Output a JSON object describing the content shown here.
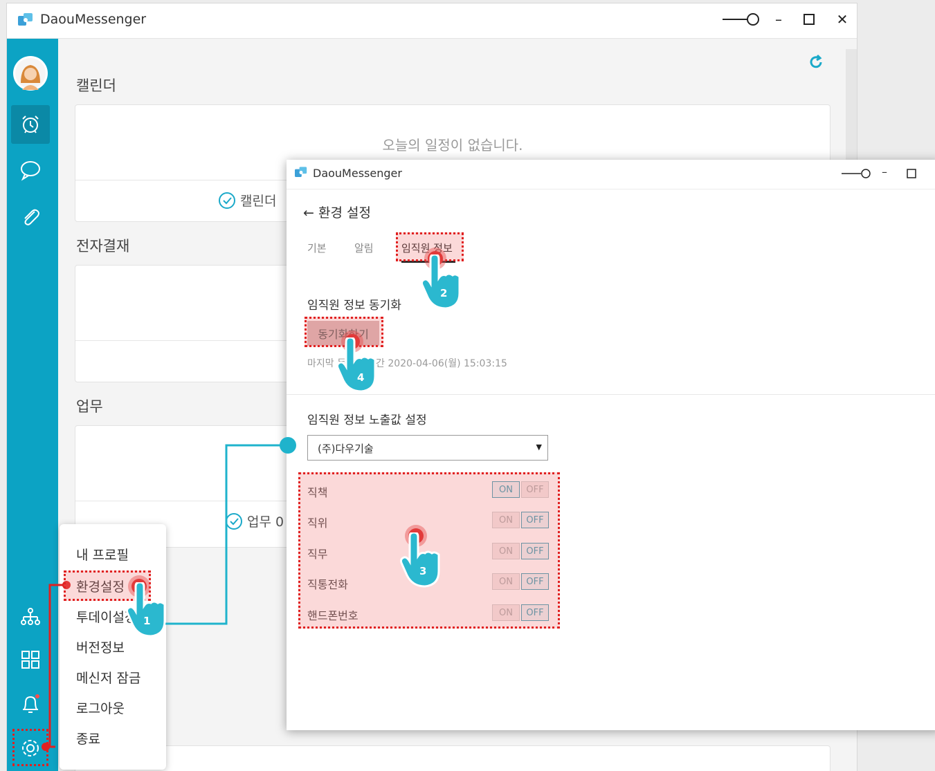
{
  "main_window": {
    "title": "DaouMessenger",
    "sections": {
      "calendar": {
        "title": "캘린더",
        "empty": "오늘의 일정이 없습니다.",
        "link": "캘린더"
      },
      "approval": {
        "title": "전자결재"
      },
      "task": {
        "title": "업무",
        "link": "업무 0"
      }
    }
  },
  "menu": {
    "items": [
      "내 프로필",
      "환경설정",
      "투데이설정",
      "버전정보",
      "메신저 잠금",
      "로그아웃",
      "종료"
    ]
  },
  "settings_window": {
    "title": "DaouMessenger",
    "header": "환경 설정",
    "tabs": [
      "기본",
      "알림",
      "임직원 정보"
    ],
    "sync_section": {
      "title": "임직원 정보 동기화",
      "button": "동기화하기",
      "last_sync": "마지막 동기화 시간 2020-04-06(월) 15:03:15"
    },
    "display_section": {
      "title": "임직원 정보 노출값 설정",
      "company": "(주)다우기술",
      "on_label": "ON",
      "off_label": "OFF",
      "rows": [
        {
          "label": "직책",
          "selected": "ON"
        },
        {
          "label": "직위",
          "selected": "OFF"
        },
        {
          "label": "직무",
          "selected": "OFF"
        },
        {
          "label": "직통전화",
          "selected": "OFF"
        },
        {
          "label": "핸드폰번호",
          "selected": "OFF"
        }
      ]
    }
  },
  "steps": [
    "1",
    "2",
    "3",
    "4"
  ],
  "colors": {
    "sidebar": "#0ca3c4",
    "annotation_red": "#e02020",
    "callout_teal": "#1fb3cc"
  }
}
